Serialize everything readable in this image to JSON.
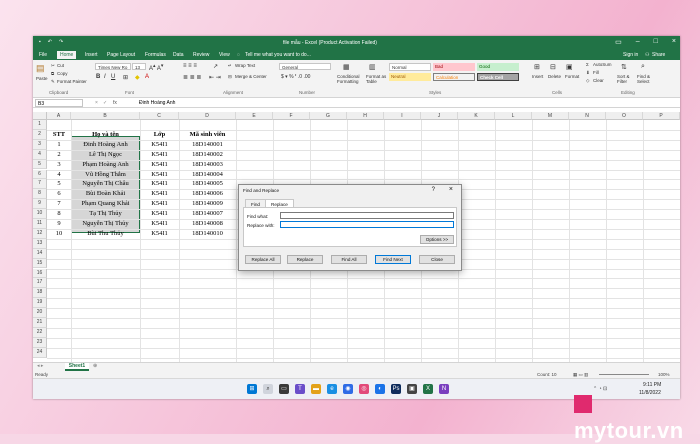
{
  "title_bar": {
    "title": "file mẫu - Excel (Product Activation Failed)",
    "search_placeholder": "Tell me what you want to do..."
  },
  "menu": [
    "File",
    "Home",
    "Insert",
    "Page Layout",
    "Formulas",
    "Data",
    "Review",
    "View"
  ],
  "menu_active": "Home",
  "account": {
    "signin": "Sign in",
    "share": "Share"
  },
  "ribbon": {
    "clipboard": {
      "paste": "Paste",
      "cut": "Cut",
      "copy": "Copy",
      "format_painter": "Format Painter",
      "label": "Clipboard"
    },
    "font": {
      "name": "Times New Ro",
      "size": "13",
      "label": "Font"
    },
    "alignment": {
      "wrap": "Wrap Text",
      "merge": "Merge & Center",
      "label": "Alignment"
    },
    "number": {
      "format": "General",
      "label": "Number"
    },
    "styles": {
      "conditional": "Conditional Formatting",
      "format_table": "Format as Table",
      "normal": "Normal",
      "bad": "Bad",
      "good": "Good",
      "neutral": "Neutral",
      "calculation": "Calculation",
      "check_cell": "Check Cell",
      "label": "Styles"
    },
    "cells": {
      "insert": "Insert",
      "delete": "Delete",
      "format": "Format",
      "label": "Cells"
    },
    "editing": {
      "autosum": "AutoSum",
      "fill": "Fill",
      "clear": "Clear",
      "sort": "Sort & Filter",
      "find": "Find & Select",
      "label": "Editing"
    }
  },
  "formula_bar": {
    "name_box": "B3",
    "fx": "fx",
    "value": "Đinh Hoàng Anh"
  },
  "columns": [
    "A",
    "B",
    "C",
    "D",
    "E",
    "F",
    "G",
    "H",
    "I",
    "J",
    "K",
    "L",
    "M",
    "N",
    "O",
    "P",
    "Q",
    "R"
  ],
  "rows": [
    "1",
    "2",
    "3",
    "4",
    "5",
    "6",
    "7",
    "8",
    "9",
    "10",
    "11",
    "12",
    "13",
    "14",
    "15",
    "16",
    "17",
    "18",
    "19",
    "20",
    "21",
    "22",
    "23",
    "24",
    "25",
    "26",
    "27",
    "28",
    "29",
    "30",
    "31",
    "32",
    "33",
    "34"
  ],
  "table": {
    "headers": [
      "STT",
      "Họ và tên",
      "Lớp",
      "Mã sinh viên"
    ],
    "rows": [
      [
        "1",
        "Đinh Hoàng Anh",
        "K54I1",
        "18D140001"
      ],
      [
        "2",
        "Lê Thị Ngọc",
        "K54I1",
        "18D140002"
      ],
      [
        "3",
        "Phạm Hoàng Anh",
        "K54I1",
        "18D140003"
      ],
      [
        "4",
        "Vũ Hồng Thắm",
        "K54I1",
        "18D140004"
      ],
      [
        "5",
        "Nguyễn Thị Châu",
        "K54I1",
        "18D140005"
      ],
      [
        "6",
        "Bùi Đoàn Khải",
        "K54I1",
        "18D140006"
      ],
      [
        "7",
        "Phạm Quang Khải",
        "K54I1",
        "18D140009"
      ],
      [
        "8",
        "Tạ Thị Thủy",
        "K54I1",
        "18D140007"
      ],
      [
        "9",
        "Nguyễn Thị Thủy",
        "K54I1",
        "18D140008"
      ],
      [
        "10",
        "Bùi Thu Thủy",
        "K54I1",
        "18D140010"
      ]
    ]
  },
  "sheet_tab": "Sheet1",
  "status": {
    "ready": "Ready",
    "count": "Count: 10",
    "zoom": "100%"
  },
  "dialog": {
    "title": "Find and Replace",
    "help": "?",
    "close": "×",
    "tabs": [
      "Find",
      "Replace"
    ],
    "find_label": "Find what:",
    "replace_label": "Replace with:",
    "options": "Options >>",
    "buttons": [
      "Replace All",
      "Replace",
      "Find All",
      "Find Next",
      "Close"
    ]
  },
  "taskbar": {
    "time": "9:11 PM",
    "date": "11/8/2022"
  },
  "watermark": "mytour.vn"
}
